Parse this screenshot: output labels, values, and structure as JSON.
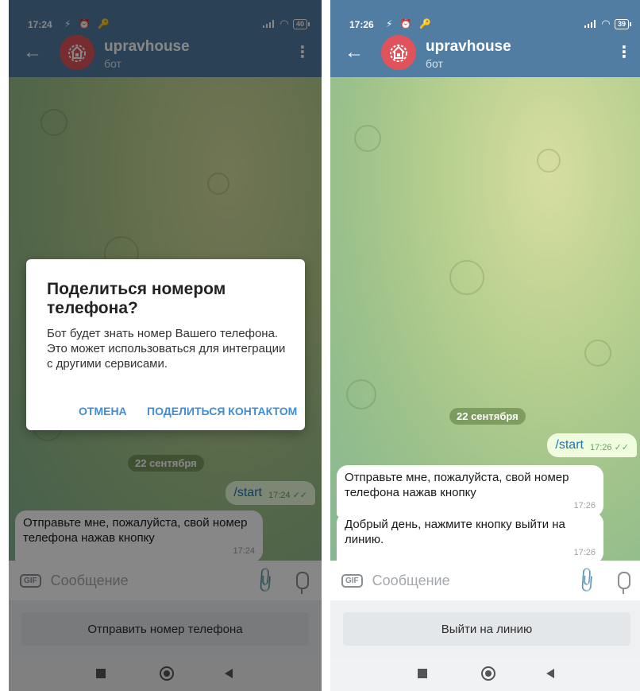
{
  "phones": [
    {
      "status": {
        "time": "17:24",
        "icons": "⚡ ⏰ 🔑",
        "battery": "40"
      },
      "header": {
        "chat_name": "upravhouse",
        "chat_subtitle": "бот"
      },
      "date_label": "22 сентября",
      "messages": [
        {
          "dir": "out",
          "text": "/start",
          "time": "17:24",
          "check": "✓✓"
        },
        {
          "dir": "in",
          "text": "Отправьте мне, пожалуйста, свой номер телефона нажав кнопку",
          "time": "17:24"
        }
      ],
      "input": {
        "placeholder": "Сообщение"
      },
      "keyboard_button": "Отправить номер телефона",
      "dialog": {
        "title": "Поделиться номером телефона?",
        "body": "Бот будет знать номер Вашего телефона. Это может использоваться для интеграции с другими сервисами.",
        "cancel": "ОТМЕНА",
        "confirm": "ПОДЕЛИТЬСЯ КОНТАКТОМ"
      }
    },
    {
      "status": {
        "time": "17:26",
        "icons": "⚡ ⏰ 🔑",
        "battery": "39"
      },
      "header": {
        "chat_name": "upravhouse",
        "chat_subtitle": "бот"
      },
      "date_label": "22 сентября",
      "messages": [
        {
          "dir": "out",
          "text": "/start",
          "time": "17:26",
          "check": "✓✓"
        },
        {
          "dir": "in",
          "text": "Отправьте мне, пожалуйста, свой номер телефона нажав кнопку",
          "time": "17:26"
        },
        {
          "dir": "in",
          "text": "Добрый день, нажмите кнопку выйти на линию.",
          "time": "17:26"
        }
      ],
      "input": {
        "placeholder": "Сообщение"
      },
      "keyboard_button": "Выйти на линию"
    }
  ],
  "colors": {
    "header": "#517da2",
    "accent": "#3f8ed4",
    "outgoing_bubble": "#effdde",
    "avatar": "#e0535a"
  }
}
